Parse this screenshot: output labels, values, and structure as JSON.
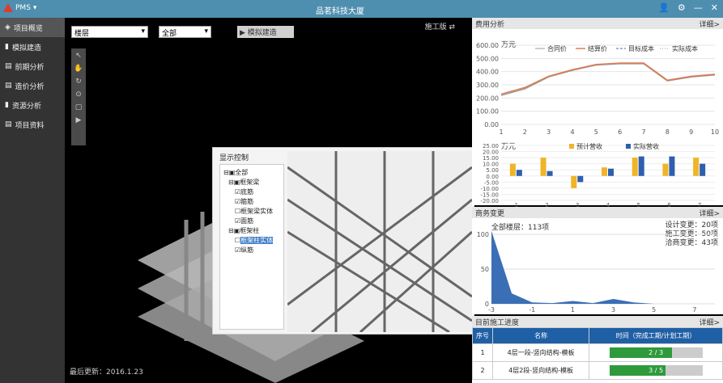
{
  "titlebar": {
    "logo_text": "PMS",
    "title": "品茗科技大厦"
  },
  "sidebar": {
    "items": [
      {
        "label": "项目概览",
        "active": true
      },
      {
        "label": "模拟建造"
      },
      {
        "label": "前期分析"
      },
      {
        "label": "造价分析"
      },
      {
        "label": "资源分析"
      },
      {
        "label": "项目资料"
      }
    ]
  },
  "viewport": {
    "floor_select": "楼层",
    "all_select": "全部",
    "sim_button": "模拟建造",
    "version_label": "施工版",
    "last_update": "最后更新：2016.1.23"
  },
  "display_control": {
    "title": "显示控制",
    "tree": [
      "全部",
      "框架梁",
      "底筋",
      "箍筋",
      "框架梁实体",
      "面筋",
      "框架柱",
      "框架柱实体",
      "纵筋"
    ]
  },
  "cost_panel": {
    "title": "费用分析",
    "detail": "详细>",
    "unit": "万元",
    "legend": [
      "合同价",
      "结算价",
      "目标成本",
      "实际成本"
    ]
  },
  "change_panel": {
    "title": "商务变更",
    "detail": "详细>",
    "summary": "全部楼层：113项",
    "stats": [
      "设计变更：20项",
      "施工变更：50项",
      "洽商变更：43项"
    ]
  },
  "progress_panel": {
    "title": "目前施工进度",
    "detail": "详细>",
    "headers": [
      "序号",
      "名称",
      "时间（完成工期/计划工期）"
    ],
    "rows": [
      {
        "no": "1",
        "name": "4层一段-竖向结构-模板",
        "text": "2 / 3",
        "fraction": 0.67
      },
      {
        "no": "2",
        "name": "4层2段-竖向结构-模板",
        "text": "3 / 5",
        "fraction": 0.6
      }
    ]
  },
  "chart_data": [
    {
      "type": "line",
      "x": [
        1,
        2,
        3,
        4,
        5,
        6,
        7,
        8,
        9,
        10
      ],
      "series": [
        {
          "name": "合同价",
          "values": [
            220,
            270,
            360,
            410,
            450,
            460,
            460,
            330,
            360,
            375
          ]
        },
        {
          "name": "结算价",
          "values": [
            230,
            280,
            365,
            415,
            455,
            465,
            465,
            335,
            365,
            380
          ]
        }
      ],
      "ylabel": "万元",
      "ylim": [
        0,
        600
      ]
    },
    {
      "type": "bar",
      "categories": [
        "1",
        "2",
        "3",
        "4",
        "5",
        "6",
        "7"
      ],
      "series": [
        {
          "name": "预计营收",
          "values": [
            10,
            15,
            -10,
            7,
            15,
            10,
            15
          ]
        },
        {
          "name": "实际营收",
          "values": [
            5,
            4,
            -5,
            6,
            16,
            16,
            10
          ]
        }
      ],
      "ylabel": "万元",
      "ylim": [
        -20,
        25
      ]
    },
    {
      "type": "area",
      "x": [
        -3,
        -2,
        -1,
        0,
        1,
        2,
        3,
        4,
        5,
        6,
        7,
        8
      ],
      "values": [
        105,
        15,
        2,
        1,
        4,
        1,
        7,
        2,
        0,
        0,
        0,
        0
      ],
      "ylim": [
        0,
        100
      ]
    }
  ]
}
